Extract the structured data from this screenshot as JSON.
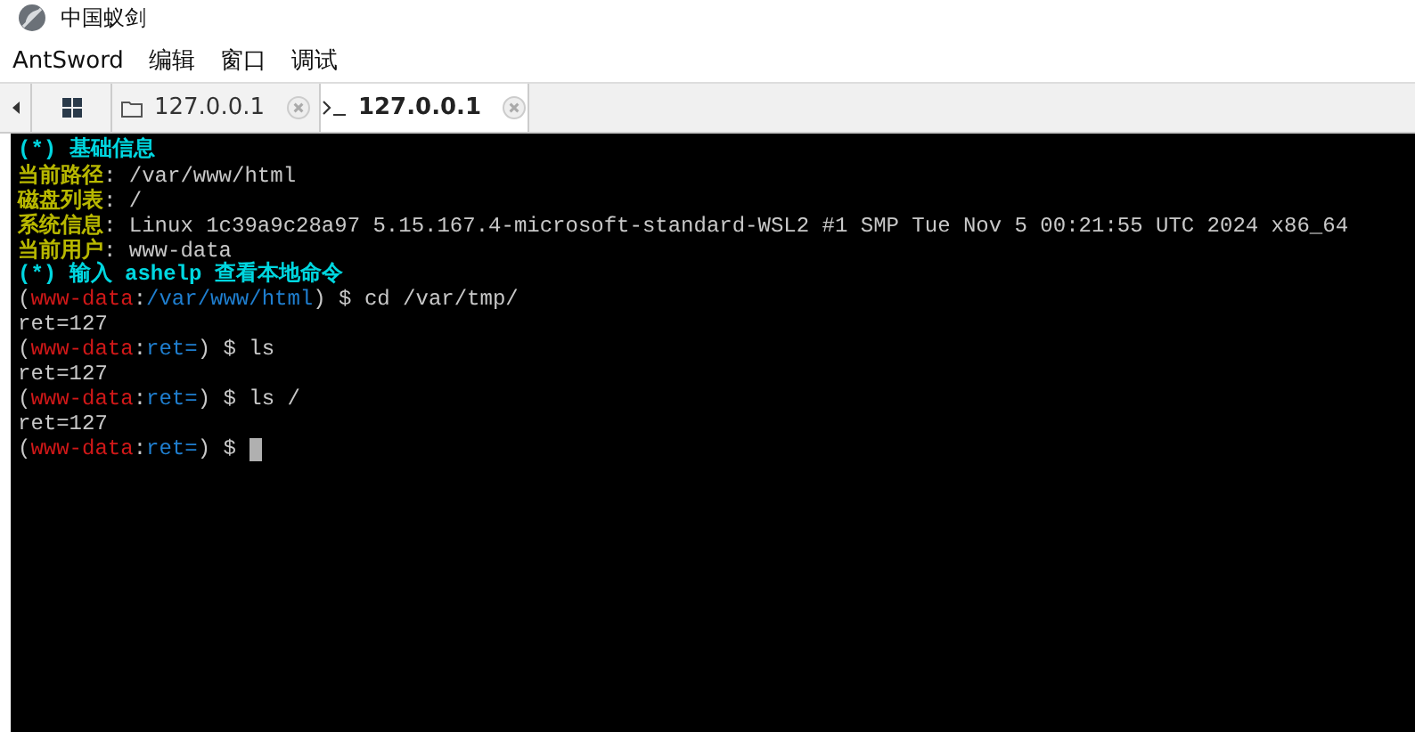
{
  "window": {
    "title": "中国蚁剑"
  },
  "menu": [
    "AntSword",
    "编辑",
    "窗口",
    "调试"
  ],
  "tabs": [
    {
      "kind": "home",
      "selected": false
    },
    {
      "kind": "files",
      "label": "127.0.0.1",
      "selected": false
    },
    {
      "kind": "terminal",
      "label": "127.0.0.1",
      "selected": true
    }
  ],
  "terminal": {
    "lines": [
      [
        {
          "kind": "heading",
          "text": "(*) 基础信息"
        }
      ],
      [
        {
          "kind": "label",
          "text": "当前路径"
        },
        {
          "kind": "plain",
          "text": ": /var/www/html"
        }
      ],
      [
        {
          "kind": "label",
          "text": "磁盘列表"
        },
        {
          "kind": "plain",
          "text": ": /"
        }
      ],
      [
        {
          "kind": "label",
          "text": "系统信息"
        },
        {
          "kind": "plain",
          "text": ": Linux 1c39a9c28a97 5.15.167.4-microsoft-standard-WSL2 #1 SMP Tue Nov 5 00:21:55 UTC 2024 x86_64"
        }
      ],
      [
        {
          "kind": "label",
          "text": "当前用户"
        },
        {
          "kind": "plain",
          "text": ": www-data"
        }
      ],
      [
        {
          "kind": "heading",
          "text": "(*) 输入 ashelp 查看本地命令"
        }
      ],
      [
        {
          "kind": "plain",
          "text": "("
        },
        {
          "kind": "user",
          "text": "www-data"
        },
        {
          "kind": "plain",
          "text": ":"
        },
        {
          "kind": "path",
          "text": "/var/www/html"
        },
        {
          "kind": "plain",
          "text": ") $ cd /var/tmp/"
        }
      ],
      [
        {
          "kind": "plain",
          "text": "ret=127"
        }
      ],
      [
        {
          "kind": "plain",
          "text": "("
        },
        {
          "kind": "user",
          "text": "www-data"
        },
        {
          "kind": "plain",
          "text": ":"
        },
        {
          "kind": "path",
          "text": "ret="
        },
        {
          "kind": "plain",
          "text": ") $ ls"
        }
      ],
      [
        {
          "kind": "plain",
          "text": "ret=127"
        }
      ],
      [
        {
          "kind": "plain",
          "text": "("
        },
        {
          "kind": "user",
          "text": "www-data"
        },
        {
          "kind": "plain",
          "text": ":"
        },
        {
          "kind": "path",
          "text": "ret="
        },
        {
          "kind": "plain",
          "text": ") $ ls /"
        }
      ],
      [
        {
          "kind": "plain",
          "text": "ret=127"
        }
      ],
      [
        {
          "kind": "plain",
          "text": "("
        },
        {
          "kind": "user",
          "text": "www-data"
        },
        {
          "kind": "plain",
          "text": ":"
        },
        {
          "kind": "path",
          "text": "ret="
        },
        {
          "kind": "plain",
          "text": ") $ "
        },
        {
          "kind": "cursor"
        }
      ]
    ]
  }
}
